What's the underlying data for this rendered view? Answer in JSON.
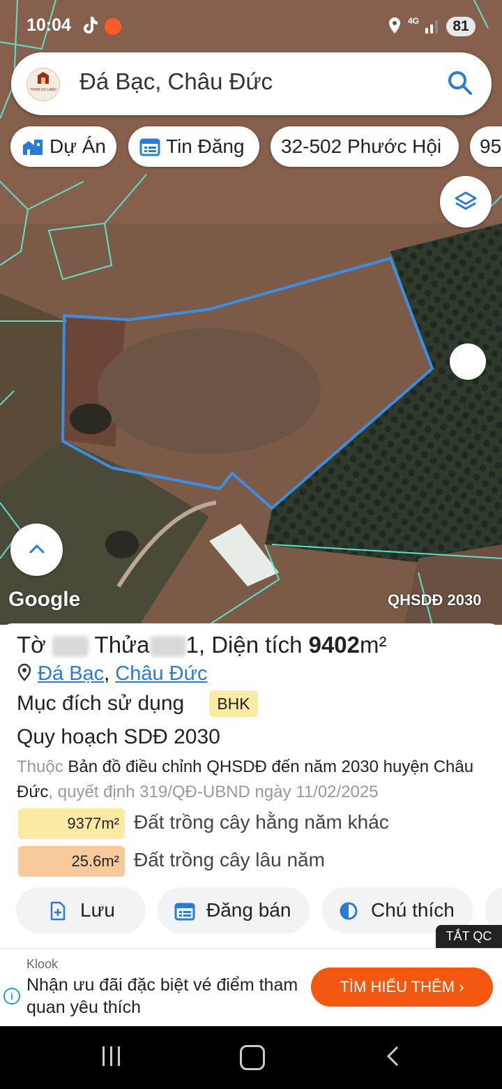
{
  "status_bar": {
    "time": "10:04",
    "network": "4G",
    "battery": "81"
  },
  "search": {
    "text": "Đá Bạc, Châu Đức",
    "logo_text": "THOM VO LAND"
  },
  "chips": [
    {
      "label": "Dự Án",
      "icon": "buildings-icon"
    },
    {
      "label": "Tin Đăng",
      "icon": "calendar-list-icon"
    },
    {
      "label": "32-502 Phước Hội"
    },
    {
      "label": "95"
    }
  ],
  "map": {
    "attribution": "Google",
    "layer_label": "QHSDĐ 2030",
    "boundary_color": "#3a8ee6",
    "parcel_line_color": "#5fe1c8"
  },
  "parcel": {
    "title_prefix": "Tờ ",
    "title_mid1": "1",
    "title_mid2": " Thửa",
    "title_mid3": "1, Diện tích ",
    "area_value": "9402",
    "area_unit": "m²",
    "location_1": "Đá Bạc",
    "location_sep": ",",
    "location_2": "Châu Đức",
    "purpose_label": "Mục đích sử dụng",
    "purpose_code": "BHK",
    "plan_title": "Quy hoạch SDĐ 2030",
    "desc_prefix": "Thuộc ",
    "desc_main": "Bản đồ điều chỉnh QHSDĐ đến năm 2030 huyện Châu Đức",
    "desc_suffix": ", quyết định 319/QĐ-UBND ngày 11/02/2025",
    "areas": [
      {
        "value": "9377m²",
        "label": "Đất trồng cây hằng năm khác",
        "color": "#fbeaa4"
      },
      {
        "value": "25.6m²",
        "label": "Đất trồng cây lâu năm",
        "color": "#f8c99a"
      }
    ]
  },
  "actions": [
    {
      "label": "Lưu"
    },
    {
      "label": "Đăng bán"
    },
    {
      "label": "Chú thích"
    }
  ],
  "ad": {
    "close_label": "TẮT QC",
    "brand": "Klook",
    "text": "Nhận ưu đãi đặc biệt vé điểm tham quan yêu thích",
    "cta": "TÌM HIỂU THÊM"
  }
}
